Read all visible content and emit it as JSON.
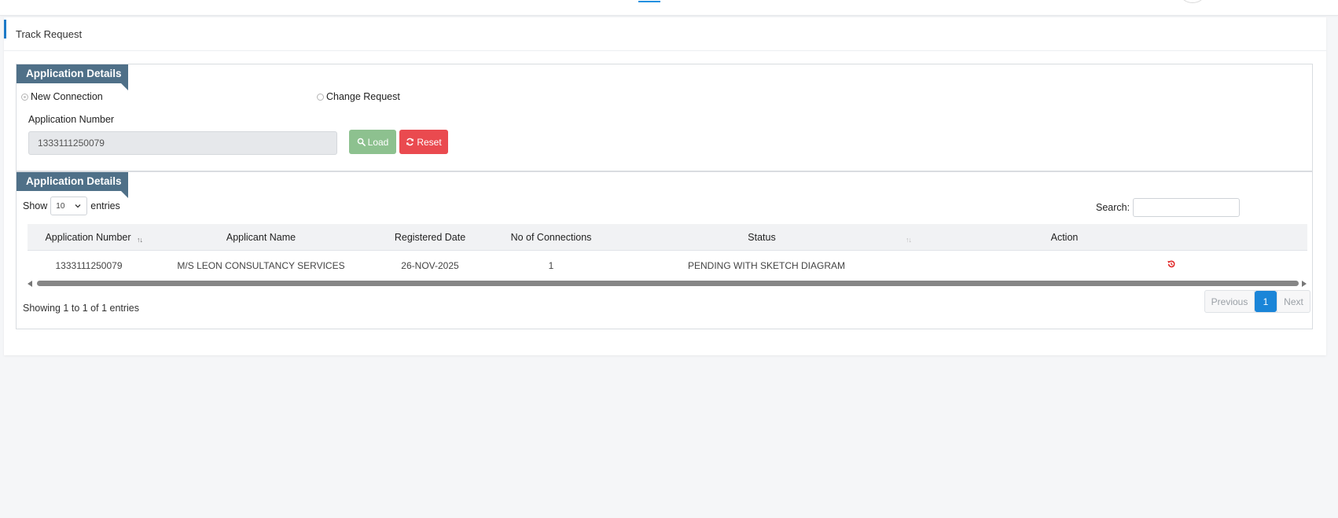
{
  "page": {
    "title": "Track Request"
  },
  "section_details": {
    "title": "Application Details",
    "radio_options": [
      {
        "label": "New Connection",
        "checked": true
      },
      {
        "label": "Change Request",
        "checked": false
      }
    ],
    "app_number_label": "Application Number",
    "app_number_value": "1333111250079",
    "load_label": "Load",
    "reset_label": "Reset"
  },
  "section_table": {
    "title": "Application Details",
    "show_label": "Show",
    "entries_label": "entries",
    "page_length": "10",
    "search_label": "Search:",
    "search_value": "",
    "columns": [
      "Application Number",
      "Applicant Name",
      "Registered Date",
      "No of Connections",
      "Status",
      "Action"
    ],
    "rows": [
      {
        "application_number": "1333111250079",
        "applicant_name": "M/S LEON CONSULTANCY SERVICES",
        "registered_date": "26-NOV-2025",
        "connections": "1",
        "status": "PENDING WITH SKETCH DIAGRAM",
        "action_icon": "undo-history-icon"
      }
    ],
    "info": "Showing 1 to 1 of 1 entries",
    "pagination": {
      "previous": "Previous",
      "current": "1",
      "next": "Next"
    }
  },
  "colors": {
    "ribbon": "#4f7088",
    "load": "#8dc18f",
    "reset": "#ea4a4f",
    "accent": "#1a85d8",
    "action_icon": "#e02424"
  }
}
